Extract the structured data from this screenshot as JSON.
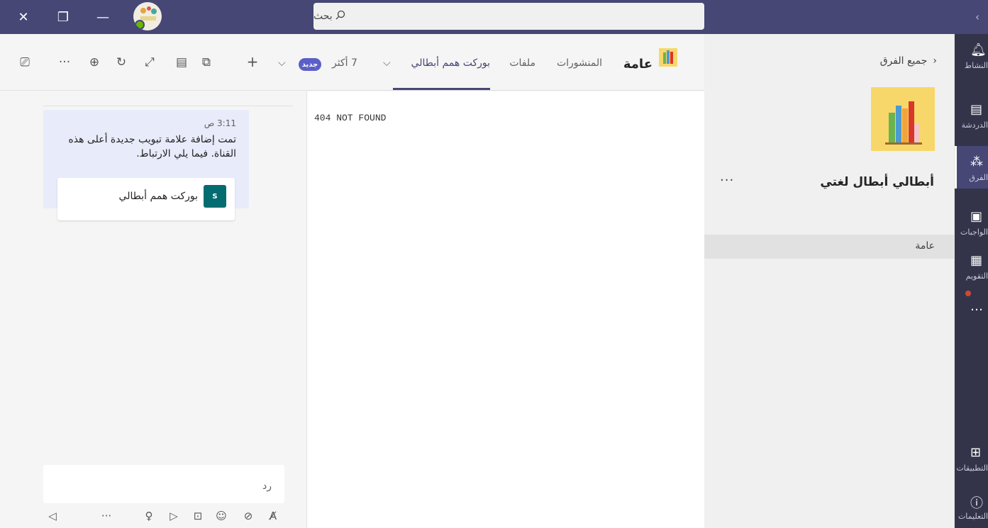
{
  "titlebar": {
    "close": "✕",
    "restore": "❐",
    "minimize": "—",
    "search_label": "بحث",
    "back": "‹"
  },
  "rail": {
    "items": [
      {
        "label": "النشاط",
        "icon": "bell-icon"
      },
      {
        "label": "الدردشة",
        "icon": "chat-icon"
      },
      {
        "label": "الفرق",
        "icon": "teams-icon"
      },
      {
        "label": "الواجبات",
        "icon": "assignments-icon"
      },
      {
        "label": "التقويم",
        "icon": "calendar-icon"
      },
      {
        "label": "…",
        "icon": "more-icon"
      },
      {
        "label": "التطبيقات",
        "icon": "apps-icon"
      },
      {
        "label": "التعليمات",
        "icon": "help-icon"
      }
    ]
  },
  "teams_panel": {
    "all_teams": "جميع الفرق",
    "team_name": "أبطالي أبطال لغتي",
    "more": "···",
    "channel": "عامة"
  },
  "channel_header": {
    "title": "عامة",
    "tabs": {
      "posts": "المنشورات",
      "files": "ملفات",
      "active": "بوركت همم أبطالي",
      "more": "7 أكثر",
      "new_badge": "جديد"
    }
  },
  "content": {
    "not_found": "404 NOT FOUND"
  },
  "conversation": {
    "time": "3:11 ص",
    "message": "تمت إضافة علامة تبويب جديدة أعلى هذه القناة. فيما يلي الارتباط.",
    "card_name": "بوركت همم أبطالي",
    "card_icon": "S",
    "reply_placeholder": "رد"
  }
}
